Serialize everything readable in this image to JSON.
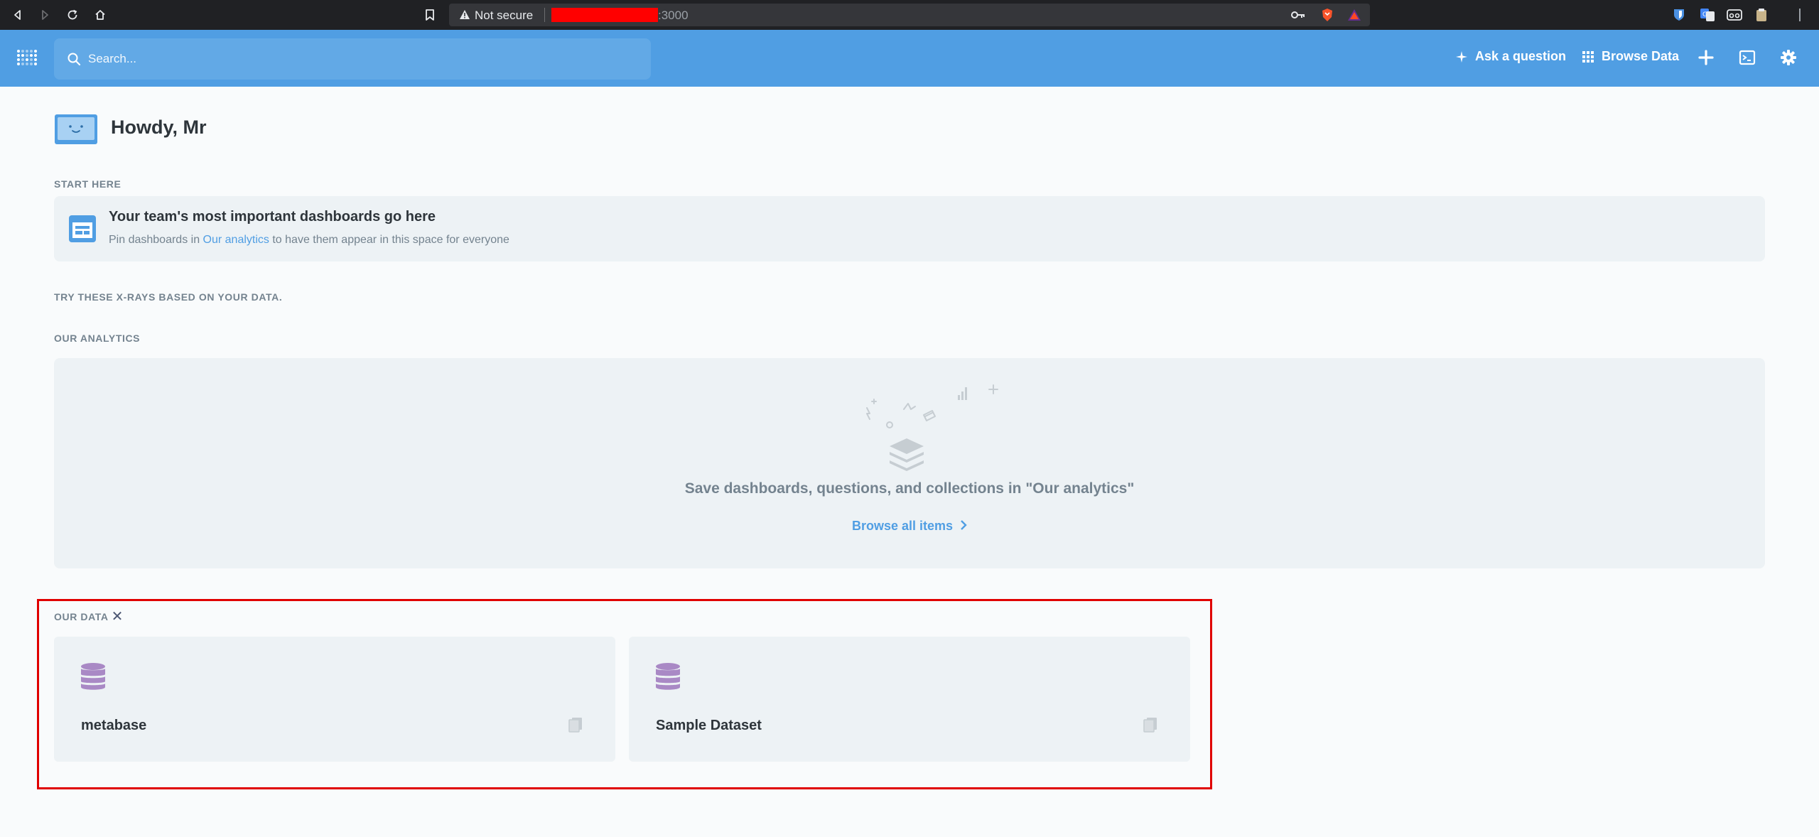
{
  "browser": {
    "security_label": "Not secure",
    "url_port": ":3000"
  },
  "header": {
    "search_placeholder": "Search...",
    "ask_question_label": "Ask a question",
    "browse_data_label": "Browse Data",
    "brand_color": "#509ee3"
  },
  "greeting": {
    "text": "Howdy, Mr"
  },
  "start_here": {
    "section_label": "Start here",
    "title": "Your team's most important dashboards go here",
    "subtitle_prefix": "Pin dashboards in ",
    "subtitle_link": "Our analytics",
    "subtitle_suffix": " to have them appear in this space for everyone"
  },
  "xrays": {
    "section_label": "Try these x-rays based on your data."
  },
  "our_analytics": {
    "section_label": "Our analytics",
    "empty_message": "Save dashboards, questions, and collections in \"Our analytics\"",
    "browse_label": "Browse all items"
  },
  "our_data": {
    "section_label": "Our data",
    "highlight_color": "#e00000",
    "databases": [
      {
        "name": "metabase",
        "icon": "database-icon",
        "icon_color": "#a989c5"
      },
      {
        "name": "Sample Dataset",
        "icon": "database-icon",
        "icon_color": "#a989c5"
      }
    ]
  }
}
